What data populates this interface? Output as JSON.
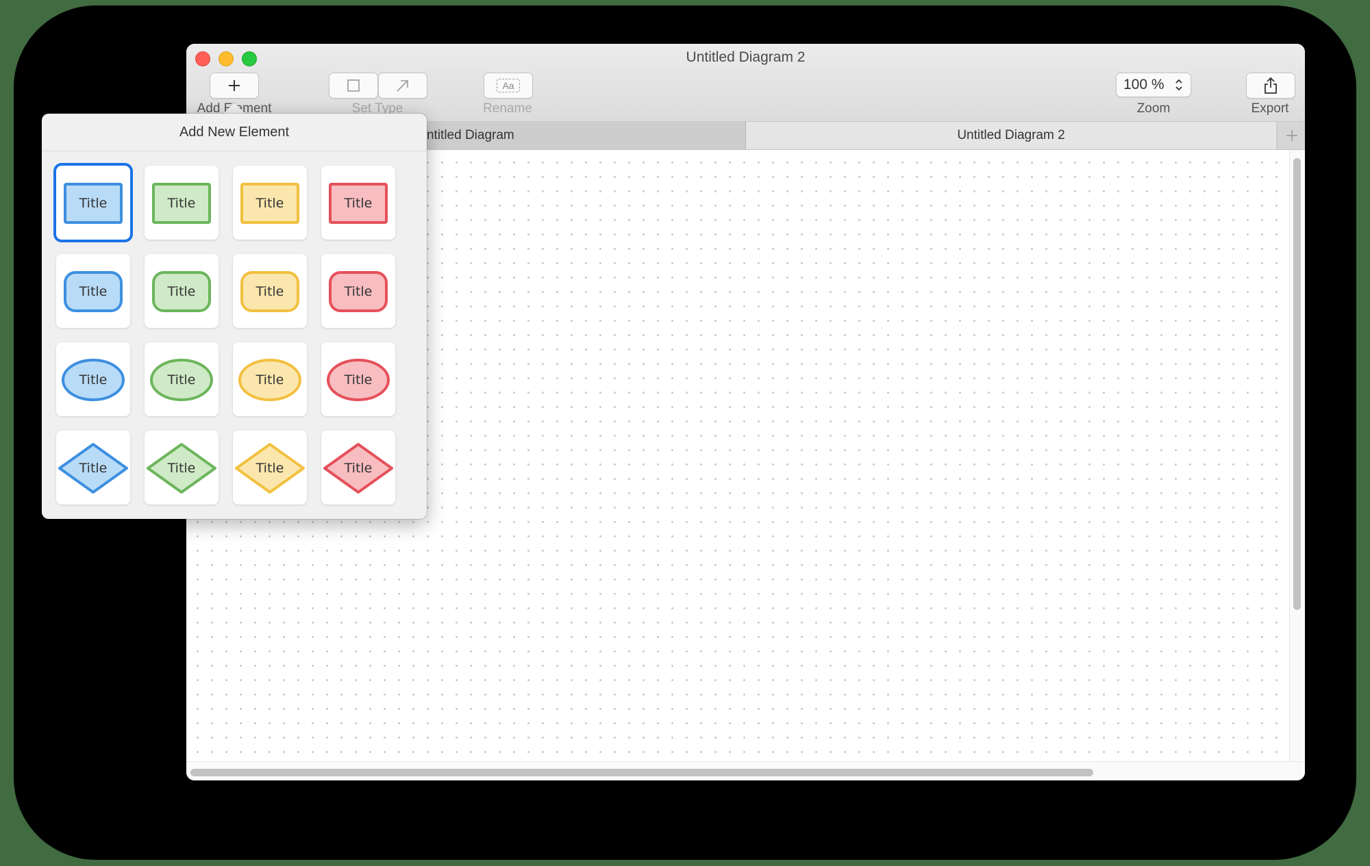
{
  "window": {
    "title": "Untitled Diagram 2"
  },
  "toolbar": {
    "add_element_label": "Add Element",
    "set_type_label": "Set Type",
    "rename_label": "Rename",
    "rename_icon_text": "Aa",
    "zoom_value": "100 %",
    "zoom_label": "Zoom",
    "export_label": "Export"
  },
  "tabs": [
    {
      "label": "Untitled Diagram",
      "state": "inactive"
    },
    {
      "label": "Untitled Diagram 2",
      "state": "active"
    }
  ],
  "popover": {
    "title": "Add New Element",
    "selected_index": 0,
    "rows": [
      {
        "shape": "rectangle"
      },
      {
        "shape": "rounded-rectangle"
      },
      {
        "shape": "ellipse"
      },
      {
        "shape": "diamond"
      }
    ],
    "palettes": [
      {
        "name": "blue",
        "stroke": "#3d8fe0",
        "fill": "#b8dbf7"
      },
      {
        "name": "green",
        "stroke": "#6cb55c",
        "fill": "#cfeac6"
      },
      {
        "name": "yellow",
        "stroke": "#f2c040",
        "fill": "#fbe7ad"
      },
      {
        "name": "red",
        "stroke": "#e5505a",
        "fill": "#f8bdc0"
      }
    ],
    "shape_label": "Title"
  }
}
